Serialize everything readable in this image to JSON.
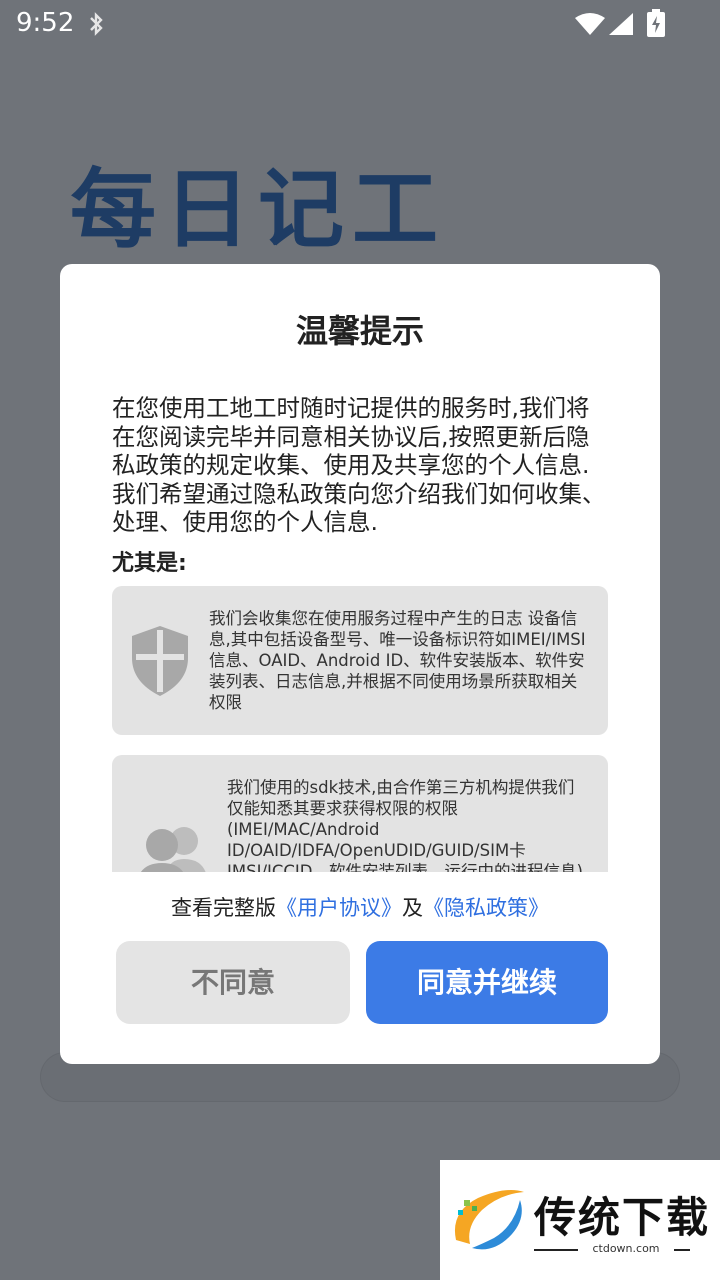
{
  "status_bar": {
    "time": "9:52",
    "icons": [
      "bluetooth-icon",
      "wifi-icon",
      "signal-icon",
      "battery-charging-icon"
    ]
  },
  "background": {
    "app_logo": "每日记工"
  },
  "dialog": {
    "title": "温馨提示",
    "intro": "在您使用工地工时随时记提供的服务时,我们将在您阅读完毕并同意相关协议后,按照更新后隐私政策的规定收集、使用及共享您的个人信息.我们希望通过隐私政策向您介绍我们如何收集、处理、使用您的个人信息.",
    "especially_label": "尤其是:",
    "cards": [
      {
        "icon": "shield-icon",
        "text": "我们会收集您在使用服务过程中产生的日志 设备信息,其中包括设备型号、唯一设备标识符如IMEI/IMSI信息、OAID、Android ID、软件安装版本、软件安装列表、日志信息,并根据不同使用场景所获取相关权限"
      },
      {
        "icon": "users-icon",
        "text": "我们使用的sdk技术,由合作第三方机构提供我们仅能知悉其要求获得权限的权限(IMEI/MAC/Android ID/OAID/IDFA/OpenUDID/GUID/SIM卡IMSI/ICCID、软件安装列表、运行中的进程信息)其使用目的的范围方式详见"
      }
    ],
    "links": {
      "prefix": "查看完整版",
      "user_agreement": "《用户协议》",
      "and": "及",
      "privacy_policy": "《隐私政策》"
    },
    "buttons": {
      "disagree": "不同意",
      "agree": "同意并继续"
    }
  },
  "watermark": {
    "title": "传统下载",
    "url": "ctdown.com"
  },
  "colors": {
    "accent": "#3c7be6",
    "overlay": "#6f7379",
    "link": "#2f6fe0"
  }
}
